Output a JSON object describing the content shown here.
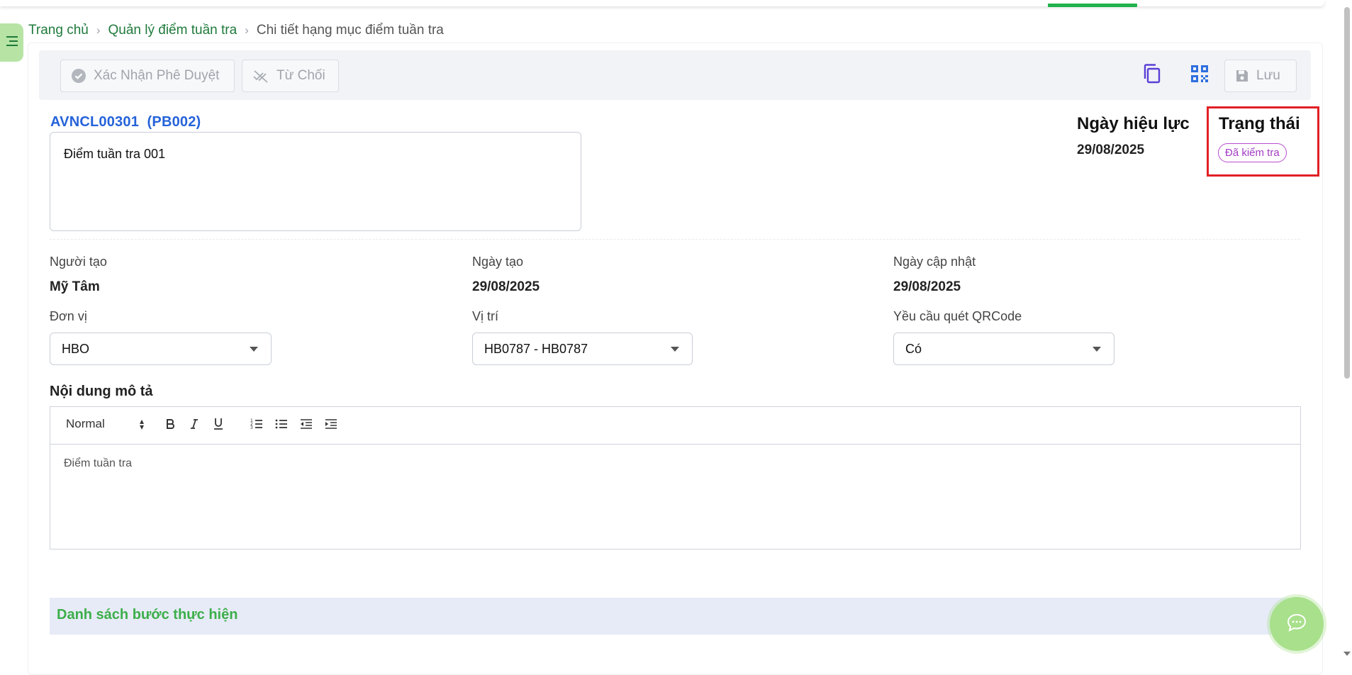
{
  "breadcrumb": {
    "home": "Trang chủ",
    "parent": "Quản lý điểm tuần tra",
    "current": "Chi tiết hạng mục điểm tuần tra"
  },
  "toolbar": {
    "approve_label": "Xác Nhận Phê Duyệt",
    "reject_label": "Từ Chối",
    "save_label": "Lưu"
  },
  "record": {
    "code": "AVNCL00301",
    "dept_code": "(PB002)",
    "name": "Điểm tuần tra 001"
  },
  "effective": {
    "label": "Ngày hiệu lực",
    "value": "29/08/2025"
  },
  "status": {
    "label": "Trạng thái",
    "value": "Đã kiểm tra",
    "color": "#a33cc4"
  },
  "meta": {
    "creator_label": "Người tạo",
    "creator_value": "Mỹ Tâm",
    "created_label": "Ngày tạo",
    "created_value": "29/08/2025",
    "updated_label": "Ngày cập nhật",
    "updated_value": "29/08/2025"
  },
  "fields": {
    "unit_label": "Đơn vị",
    "unit_value": "HBO",
    "location_label": "Vị trí",
    "location_value": "HB0787 - HB0787",
    "qr_label": "Yều cầu quét QRCode",
    "qr_value": "Có"
  },
  "description": {
    "label": "Nội dung mô tả",
    "format": "Normal",
    "content": "Điểm tuần tra"
  },
  "steps": {
    "title": "Danh sách bước thực hiện"
  },
  "colors": {
    "brand_green": "#1f7a3b",
    "link_blue": "#2563d9",
    "highlight_red": "#e21f26"
  }
}
